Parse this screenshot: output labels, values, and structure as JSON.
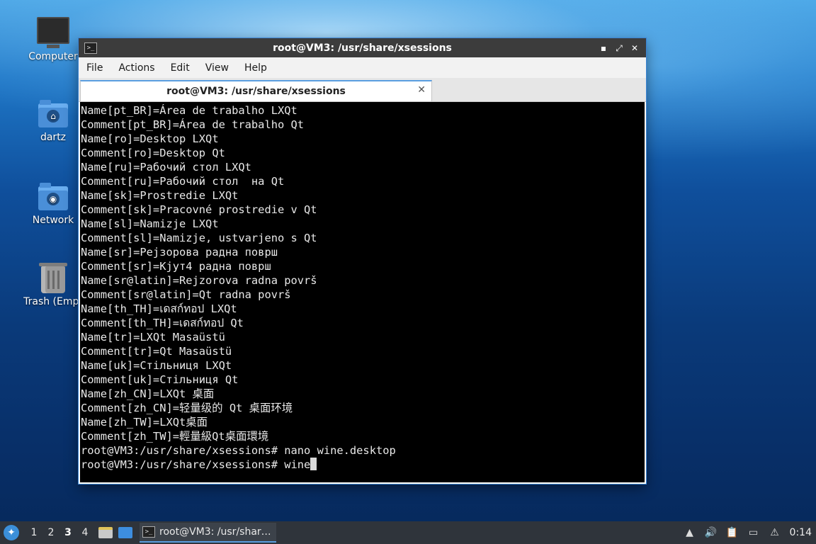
{
  "desktop": {
    "icons": [
      {
        "label": "Computer"
      },
      {
        "label": "dartz"
      },
      {
        "label": "Network"
      },
      {
        "label": "Trash (Empt"
      }
    ]
  },
  "window": {
    "title": "root@VM3: /usr/share/xsessions",
    "controls": {
      "minimize": "▪",
      "maximize": "⤢",
      "close": "✕"
    },
    "menu": [
      "File",
      "Actions",
      "Edit",
      "View",
      "Help"
    ],
    "tab": {
      "label": "root@VM3: /usr/share/xsessions",
      "close": "✕"
    }
  },
  "terminal": {
    "lines": [
      "Name[pt_BR]=Área de trabalho LXQt",
      "Comment[pt_BR]=Área de trabalho Qt",
      "Name[ro]=Desktop LXQt",
      "Comment[ro]=Desktop Qt",
      "Name[ru]=Рабочий стол LXQt",
      "Comment[ru]=Рабочий стол  на Qt",
      "Name[sk]=Prostredie LXQt",
      "Comment[sk]=Pracovné prostredie v Qt",
      "Name[sl]=Namizje LXQt",
      "Comment[sl]=Namizje, ustvarjeno s Qt",
      "Name[sr]=Рејзорова радна површ",
      "Comment[sr]=Кјут4 радна површ",
      "Name[sr@latin]=Rejzorova radna površ",
      "Comment[sr@latin]=Qt radna površ",
      "Name[th_TH]=เดสก์ทอป LXQt",
      "Comment[th_TH]=เดสก์ทอป Qt",
      "Name[tr]=LXQt Masaüstü",
      "Comment[tr]=Qt Masaüstü",
      "Name[uk]=Стільниця LXQt",
      "Comment[uk]=Стільниця Qt",
      "Name[zh_CN]=LXQt 桌面",
      "Comment[zh_CN]=轻量级的 Qt 桌面环境",
      "Name[zh_TW]=LXQt桌面",
      "Comment[zh_TW]=輕量級Qt桌面環境",
      "root@VM3:/usr/share/xsessions# nano wine.desktop",
      "root@VM3:/usr/share/xsessions# wine"
    ]
  },
  "taskbar": {
    "workspaces": [
      "1",
      "2",
      "3",
      "4"
    ],
    "active_workspace": "3",
    "task_label": "root@VM3: /usr/shar…",
    "clock": "0:14"
  }
}
